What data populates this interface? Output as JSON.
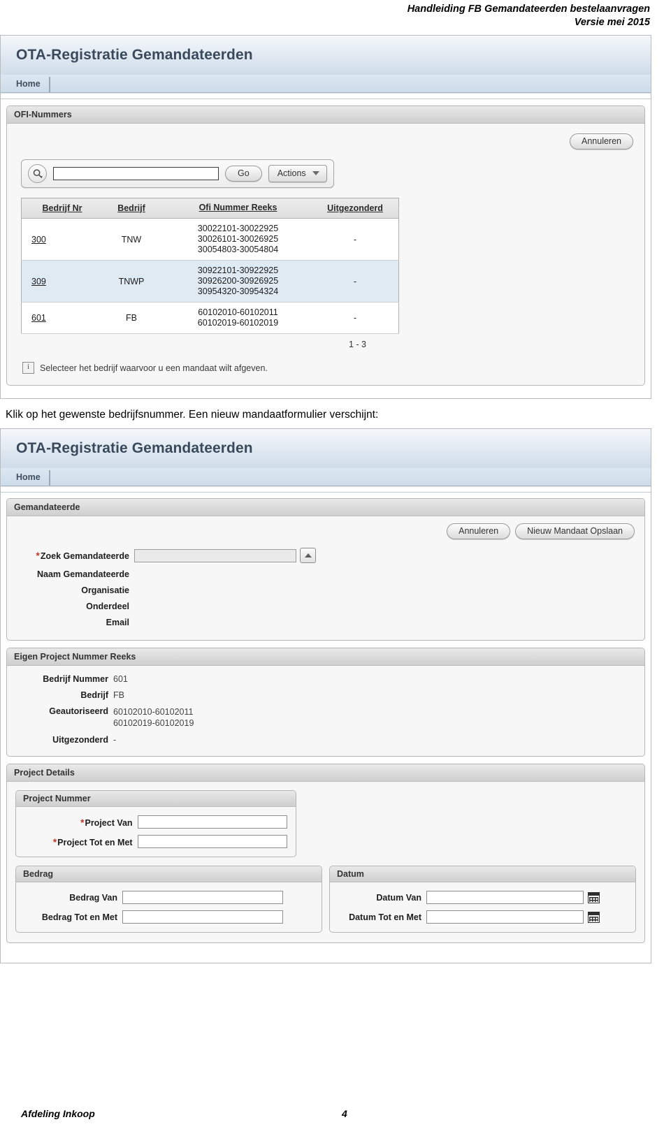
{
  "document": {
    "header_line1": "Handleiding FB Gemandateerden bestelaanvragen",
    "header_line2": "Versie mei 2015",
    "footer_left": "Afdeling Inkoop",
    "footer_page": "4",
    "body_text": "Klik op het gewenste bedrijfsnummer. Een nieuw mandaatformulier verschijnt:"
  },
  "screenshot1": {
    "app_title": "OTA-Registratie Gemandateerden",
    "tab_home": "Home",
    "region_title": "OFI-Nummers",
    "cancel_label": "Annuleren",
    "search": {
      "value": "",
      "placeholder": "",
      "go_label": "Go",
      "actions_label": "Actions",
      "search_icon": "search-icon",
      "caret_icon": "chevron-down-icon"
    },
    "table": {
      "headers": [
        "Bedrijf Nr",
        "Bedrijf",
        "Ofi Nummer Reeks",
        "Uitgezonderd"
      ],
      "rows": [
        {
          "bedrijf_nr": "300",
          "bedrijf": "TNW",
          "reeks": [
            "30022101-30022925",
            "30026101-30026925",
            "30054803-30054804"
          ],
          "uitgezonderd": "-"
        },
        {
          "bedrijf_nr": "309",
          "bedrijf": "TNWP",
          "reeks": [
            "30922101-30922925",
            "30926200-30926925",
            "30954320-30954324"
          ],
          "uitgezonderd": "-"
        },
        {
          "bedrijf_nr": "601",
          "bedrijf": "FB",
          "reeks": [
            "60102010-60102011",
            "60102019-60102019"
          ],
          "uitgezonderd": "-"
        }
      ],
      "pager": "1 - 3"
    },
    "info_message": "Selecteer het bedrijf waarvoor u een mandaat wilt afgeven.",
    "info_icon": "info-icon"
  },
  "screenshot2": {
    "app_title": "OTA-Registratie Gemandateerden",
    "tab_home": "Home",
    "gemandateerde": {
      "region_title": "Gemandateerde",
      "cancel_label": "Annuleren",
      "save_label": "Nieuw Mandaat Opslaan",
      "fields": [
        {
          "label": "Zoek Gemandateerde",
          "required": true,
          "value": "",
          "has_picker": true
        },
        {
          "label": "Naam Gemandateerde",
          "required": false,
          "value": ""
        },
        {
          "label": "Organisatie",
          "required": false,
          "value": ""
        },
        {
          "label": "Onderdeel",
          "required": false,
          "value": ""
        },
        {
          "label": "Email",
          "required": false,
          "value": ""
        }
      ],
      "picker_icon": "picker-up-icon"
    },
    "eigen_reeks": {
      "region_title": "Eigen Project Nummer Reeks",
      "rows": [
        {
          "label": "Bedrijf Nummer",
          "value": "601"
        },
        {
          "label": "Bedrijf",
          "value": "FB"
        },
        {
          "label": "Geautoriseerd",
          "value": "60102010-60102011\n60102019-60102019"
        },
        {
          "label": "Uitgezonderd",
          "value": "-"
        }
      ]
    },
    "project_details": {
      "region_title": "Project Details",
      "project_nummer": {
        "title": "Project Nummer",
        "fields": [
          {
            "label": "Project Van",
            "required": true,
            "value": ""
          },
          {
            "label": "Project Tot en Met",
            "required": true,
            "value": ""
          }
        ]
      },
      "bedrag": {
        "title": "Bedrag",
        "fields": [
          {
            "label": "Bedrag Van",
            "required": false,
            "value": ""
          },
          {
            "label": "Bedrag Tot en Met",
            "required": false,
            "value": ""
          }
        ]
      },
      "datum": {
        "title": "Datum",
        "calendar_icon": "calendar-icon",
        "fields": [
          {
            "label": "Datum Van",
            "required": false,
            "value": ""
          },
          {
            "label": "Datum Tot en Met",
            "required": false,
            "value": ""
          }
        ]
      }
    }
  }
}
